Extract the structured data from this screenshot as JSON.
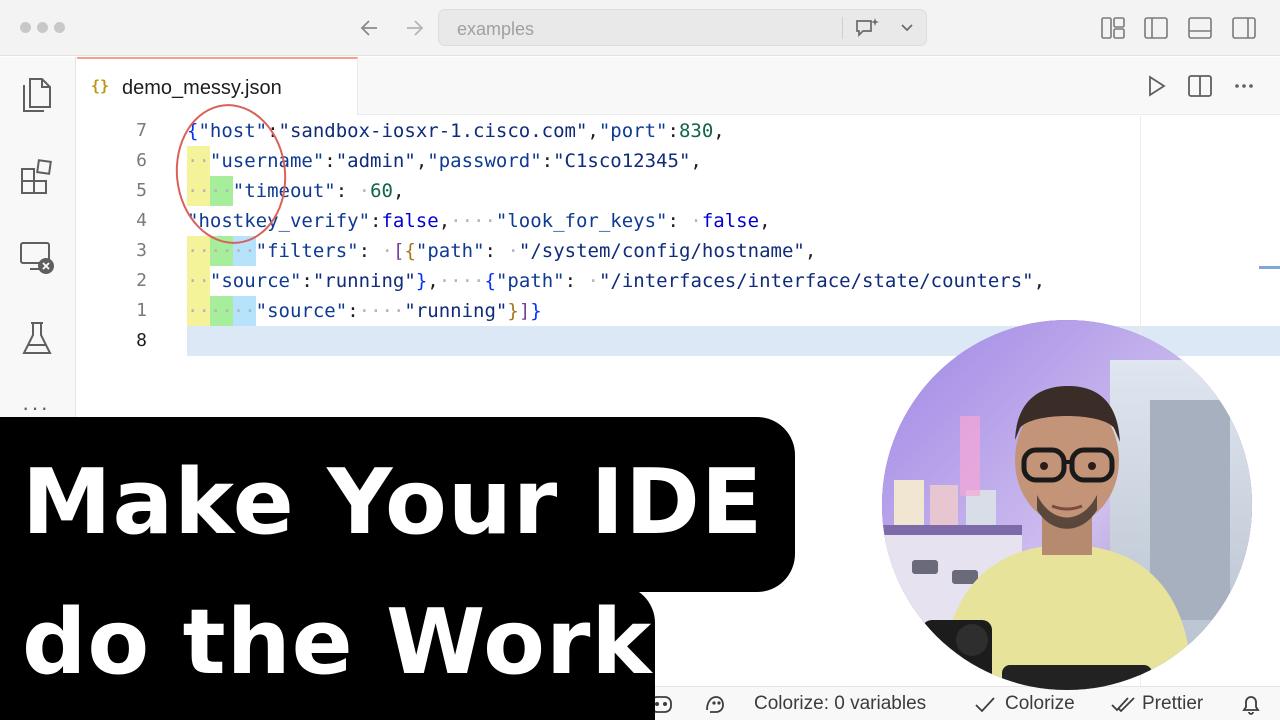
{
  "titlebar": {
    "search_placeholder": "examples",
    "icons": [
      "back-arrow-icon",
      "forward-arrow-icon",
      "chat-sparkle-icon",
      "chevron-down-icon",
      "layout-panels-icon",
      "toggle-left-sidebar-icon",
      "toggle-panel-icon",
      "toggle-right-sidebar-icon"
    ]
  },
  "activitybar": {
    "items": [
      "explorer-icon",
      "extensions-icon",
      "remote-explorer-icon",
      "testing-icon"
    ],
    "more": "···"
  },
  "tab": {
    "icon_text": "{}",
    "label": "demo_messy.json"
  },
  "editor": {
    "line_numbers": [
      "7",
      "6",
      "5",
      "4",
      "3",
      "2",
      "1",
      "8"
    ],
    "lines": [
      "{\"host\":\"sandbox-iosxr-1.cisco.com\",\"port\":830,",
      "··\"username\":\"admin\",\"password\":\"C1sco12345\",",
      "····\"timeout\": ·60,",
      "\"hostkey_verify\":false,····\"look_for_keys\": ·false,",
      "······\"filters\": ·[{\"path\": ·\"/system/config/hostname\",",
      "··\"source\":\"running\"},····{\"path\": ·\"/interfaces/interface/state/counters\",",
      "······\"source\":····\"running\"}]}",
      ""
    ]
  },
  "statusbar": {
    "colorize_vars": "Colorize: 0 variables",
    "colorize": "Colorize",
    "prettier": "Prettier"
  },
  "overlay": {
    "line1": "Make Your IDE",
    "line2": "do the Work"
  },
  "colors": {
    "accent_tab": "#f4a08a",
    "indent_yellow": "#f4f39a",
    "indent_green": "#a7ee9c",
    "indent_blue": "#b7e2fb",
    "annotation": "#d9615a"
  }
}
